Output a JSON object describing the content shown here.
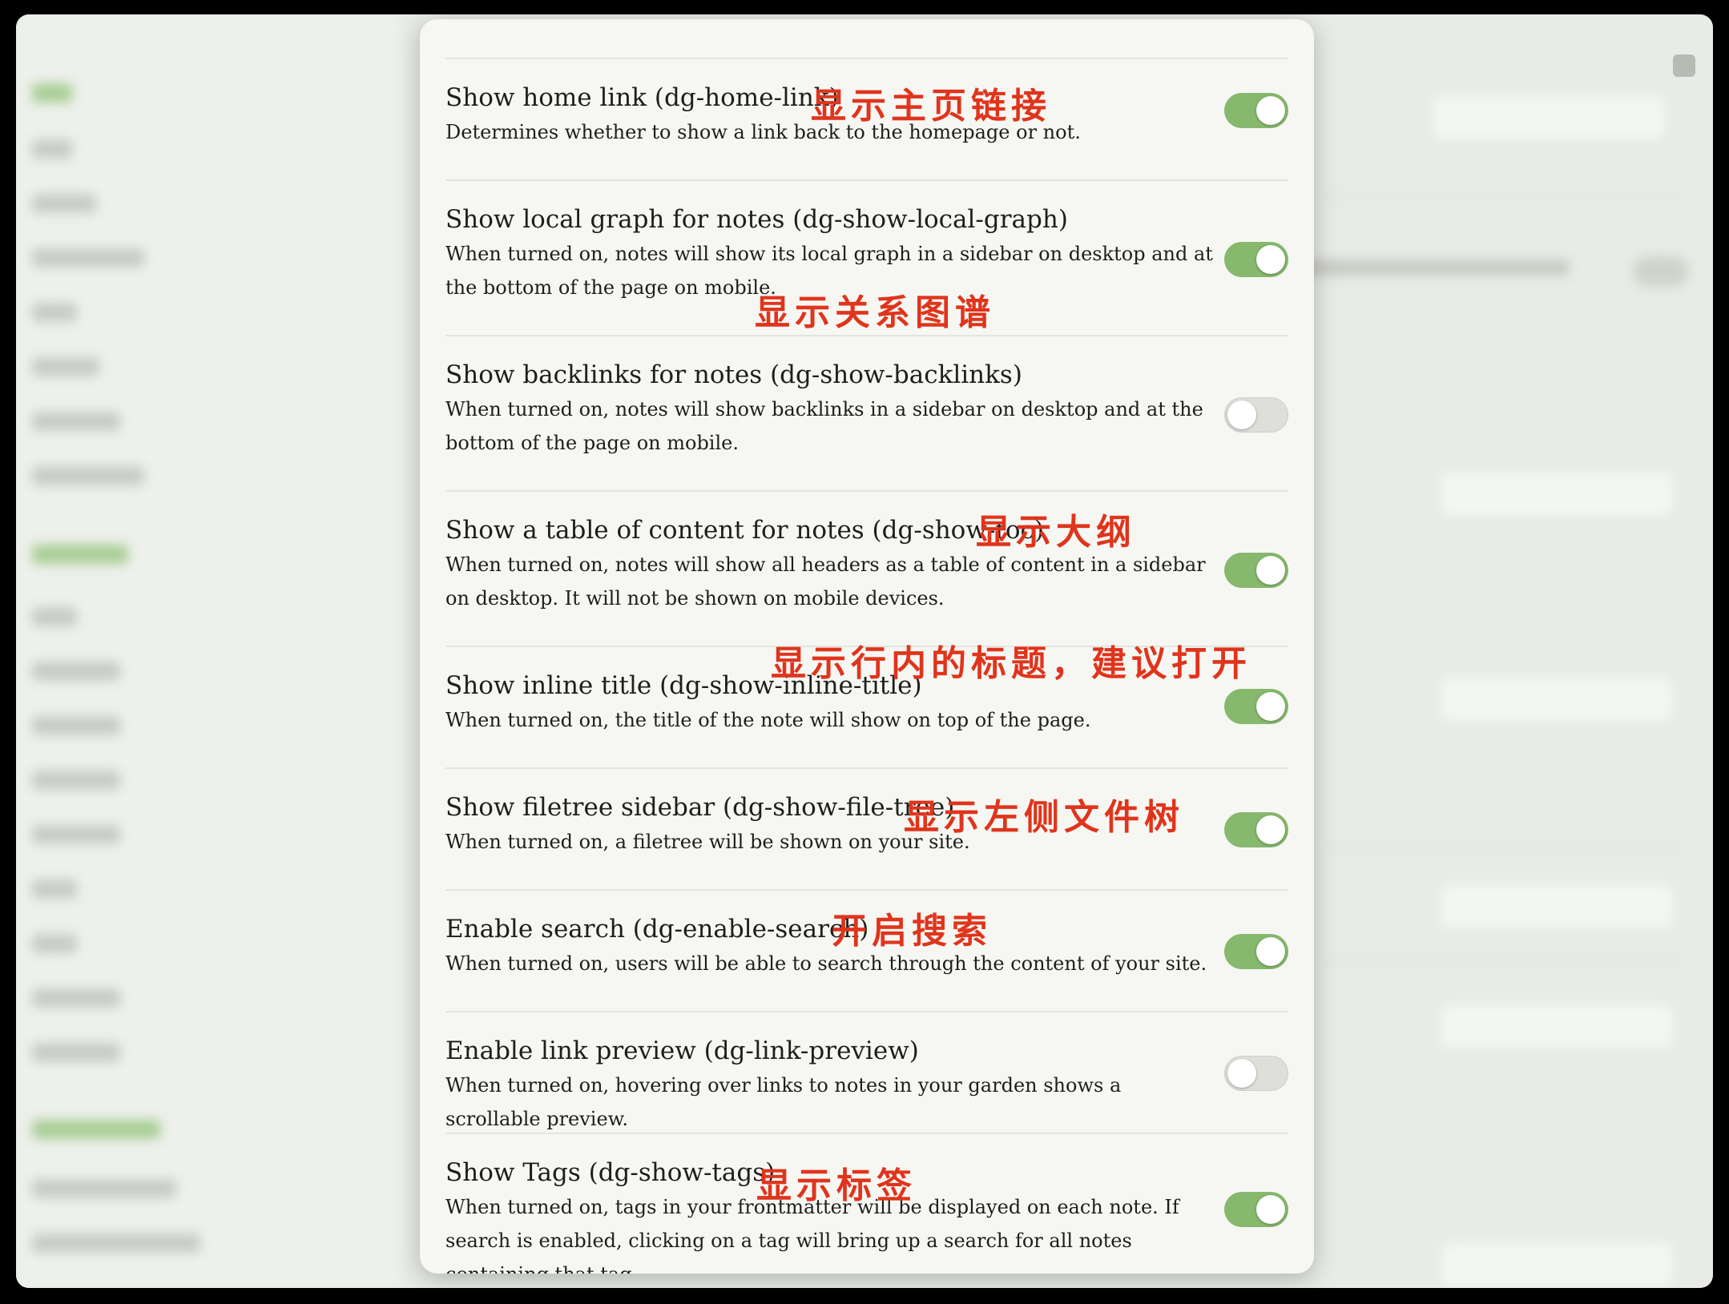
{
  "colors": {
    "toggle_on": "#86b86d",
    "toggle_off": "#dedfdb",
    "annotation": "#e0341c",
    "modal_bg": "#f6f7f3"
  },
  "settings": [
    {
      "title": "Show home link (dg-home-link)",
      "description": "Determines whether to show a link back to the homepage or not.",
      "enabled": true,
      "annotation": "显示主页链接"
    },
    {
      "title": "Show local graph for notes (dg-show-local-graph)",
      "description": "When turned on, notes will show its local graph in a sidebar on desktop and at the bottom of the page on mobile.",
      "enabled": true,
      "annotation": "显示关系图谱"
    },
    {
      "title": "Show backlinks for notes (dg-show-backlinks)",
      "description": "When turned on, notes will show backlinks in a sidebar on desktop and at the bottom of the page on mobile.",
      "enabled": false,
      "annotation": ""
    },
    {
      "title": "Show a table of content for notes (dg-show-toc)",
      "description": "When turned on, notes will show all headers as a table of content in a sidebar on desktop. It will not be shown on mobile devices.",
      "enabled": true,
      "annotation": "显示大纲"
    },
    {
      "title": "Show inline title (dg-show-inline-title)",
      "description": "When turned on, the title of the note will show on top of the page.",
      "enabled": true,
      "annotation": "显示行内的标题，建议打开"
    },
    {
      "title": "Show filetree sidebar (dg-show-file-tree)",
      "description": "When turned on, a filetree will be shown on your site.",
      "enabled": true,
      "annotation": "显示左侧文件树"
    },
    {
      "title": "Enable search (dg-enable-search)",
      "description": "When turned on, users will be able to search through the content of your site.",
      "enabled": true,
      "annotation": "开启搜索"
    },
    {
      "title": "Enable link preview (dg-link-preview)",
      "description": "When turned on, hovering over links to notes in your garden shows a scrollable preview.",
      "enabled": false,
      "annotation": ""
    },
    {
      "title": "Show Tags (dg-show-tags)",
      "description": "When turned on, tags in your frontmatter will be displayed on each note. If search is enabled, clicking on a tag will bring up a search for all notes containing that tag.",
      "enabled": true,
      "annotation": "显示标签"
    }
  ]
}
